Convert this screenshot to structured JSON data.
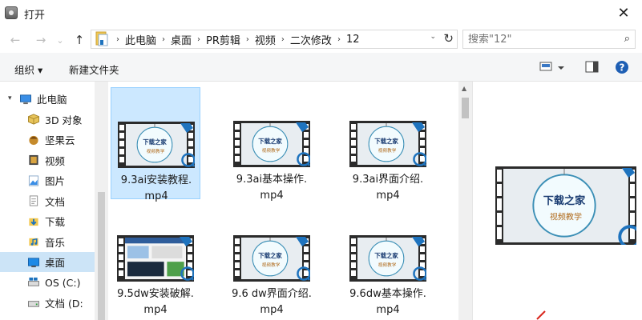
{
  "window": {
    "title": "打开",
    "close_glyph": "✕"
  },
  "nav": {
    "back": "←",
    "forward": "→",
    "recent": "⌄",
    "up": "↑"
  },
  "address": {
    "crumbs": [
      "此电脑",
      "桌面",
      "PR剪辑",
      "视频",
      "二次修改",
      "12"
    ],
    "separator": "›",
    "dropdown": "⌄",
    "refresh": "↻"
  },
  "search": {
    "value": "",
    "placeholder": "搜索\"12\"",
    "icon": "⌕"
  },
  "toolbar": {
    "organize": "组织 ▾",
    "new_folder": "新建文件夹",
    "help": "?"
  },
  "sidebar": {
    "items": [
      {
        "label": "此电脑",
        "icon": "pc-icon"
      },
      {
        "label": "3D 对象",
        "icon": "3d-objects-icon"
      },
      {
        "label": "坚果云",
        "icon": "nutstore-icon"
      },
      {
        "label": "视频",
        "icon": "videos-icon"
      },
      {
        "label": "图片",
        "icon": "pictures-icon"
      },
      {
        "label": "文档",
        "icon": "documents-icon"
      },
      {
        "label": "下载",
        "icon": "downloads-icon"
      },
      {
        "label": "音乐",
        "icon": "music-icon"
      },
      {
        "label": "桌面",
        "icon": "desktop-icon",
        "selected": true
      },
      {
        "label": "OS (C:)",
        "icon": "drive-c-icon"
      },
      {
        "label": "文档 (D:",
        "icon": "drive-d-icon"
      }
    ]
  },
  "files": [
    {
      "line1": "9.3ai安装教程.",
      "line2": "mp4",
      "selected": true,
      "style": "logo"
    },
    {
      "line1": "9.3ai基本操作.",
      "line2": "mp4",
      "style": "logo"
    },
    {
      "line1": "9.3ai界面介绍.",
      "line2": "mp4",
      "style": "logo"
    },
    {
      "line1": "9.5dw安装破解.",
      "line2": "mp4",
      "style": "screen"
    },
    {
      "line1": "9.6 dw界面介绍.",
      "line2": "mp4",
      "style": "logo"
    },
    {
      "line1": "9.6dw基本操作.",
      "line2": "mp4",
      "style": "logo"
    }
  ],
  "thumb_text": {
    "line1": "下载之家",
    "line2": "视频教学"
  },
  "colors": {
    "selection": "#cce8ff",
    "accent": "#1e73be",
    "filmstrip": "#2b2b2b"
  }
}
